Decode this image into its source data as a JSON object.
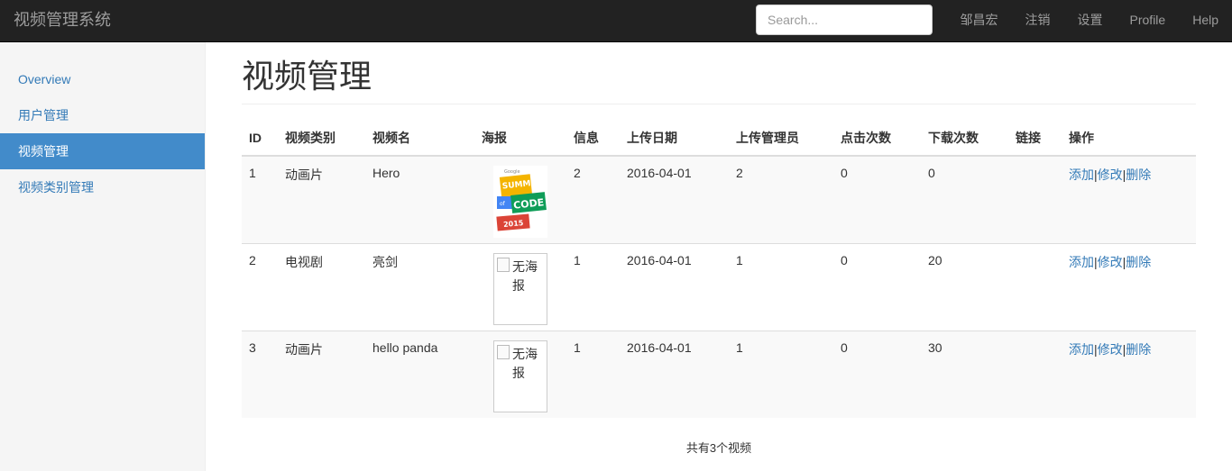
{
  "navbar": {
    "brand": "视频管理系统",
    "search_placeholder": "Search...",
    "links": [
      "邹昌宏",
      "注销",
      "设置",
      "Profile",
      "Help"
    ]
  },
  "sidebar": {
    "items": [
      {
        "label": "Overview"
      },
      {
        "label": "用户管理"
      },
      {
        "label": "视频管理"
      },
      {
        "label": "视频类别管理"
      }
    ]
  },
  "main": {
    "title": "视频管理",
    "columns": [
      "ID",
      "视频类别",
      "视频名",
      "海报",
      "信息",
      "上传日期",
      "上传管理员",
      "点击次数",
      "下载次数",
      "链接",
      "操作"
    ],
    "rows": [
      {
        "id": "1",
        "category": "动画片",
        "name": "Hero",
        "poster": "image",
        "info": "2",
        "date": "2016-04-01",
        "admin": "2",
        "clicks": "0",
        "downloads": "0",
        "link": "",
        "add": "添加",
        "edit": "修改",
        "del": "删除"
      },
      {
        "id": "2",
        "category": "电视剧",
        "name": "亮剑",
        "poster": "无海报",
        "info": "1",
        "date": "2016-04-01",
        "admin": "1",
        "clicks": "0",
        "downloads": "20",
        "link": "",
        "add": "添加",
        "edit": "修改",
        "del": "删除"
      },
      {
        "id": "3",
        "category": "动画片",
        "name": "hello panda",
        "poster": "无海报",
        "info": "1",
        "date": "2016-04-01",
        "admin": "1",
        "clicks": "0",
        "downloads": "30",
        "link": "",
        "add": "添加",
        "edit": "修改",
        "del": "删除"
      }
    ],
    "action_sep": "|",
    "poster_logo": {
      "brand": "Google",
      "line1": "SUMMER",
      "line2": "of",
      "line3": "CODE",
      "year": "2015"
    },
    "footer": "共有3个视频"
  },
  "colors": {
    "navbar_bg": "#222222",
    "sidebar_bg": "#f5f5f5",
    "active_bg": "#428bca",
    "link": "#337ab7"
  }
}
